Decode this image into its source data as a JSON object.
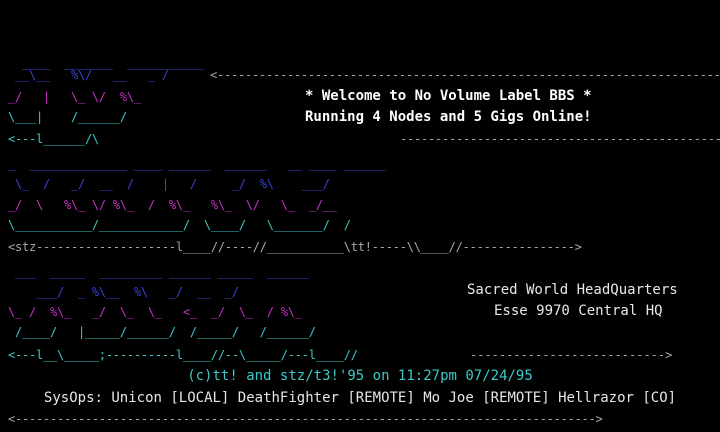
{
  "colors": {
    "background": "#000000",
    "cyan": "#3ec8c8",
    "blue": "#3a43d6",
    "magenta": "#c832c8",
    "gray": "#a8a8a8",
    "white": "#ffffff"
  },
  "header": {
    "welcome": "* Welcome to No Volume Label BBS *",
    "running": "Running 4 Nodes and 5 Gigs Online!"
  },
  "hq": {
    "line1": "Sacred World HeadQuarters",
    "line2": "Esse 9970 Central HQ"
  },
  "credits": "(c)tt! and stz/t3!'95 on 11:27pm 07/24/95",
  "sysops": "SysOps: Unicon [LOCAL] DeathFighter [REMOTE] Mo Joe [REMOTE] Hellrazor [CO]",
  "art": {
    "logo1": [
      {
        "text": "  ____  _______  ___________",
        "color": "blue"
      },
      {
        "text": " __\\__   %\\/   __   _ /",
        "color": "blue"
      },
      {
        "text": "_/   |   \\_ \\/  %\\_",
        "color": "magenta"
      },
      {
        "text": "\\___|    /______/",
        "color": "cyan"
      },
      {
        "text": "<---l______/\\",
        "color": "cyan"
      }
    ],
    "logo2": [
      {
        "text": "_  ______________ ____ ______  ______   __ ____ ______",
        "color": "blue"
      },
      {
        "text": " \\_  /   _/  __  /    |   /     _/  %\\    ___/",
        "color": "blue"
      },
      {
        "text": "_/  \\   %\\_ \\/ %\\_  /  %\\_   %\\_  \\/   \\_  _/__",
        "color": "magenta"
      },
      {
        "text": "\\___________/____________/  \\____/   \\_______/  /",
        "color": "cyan"
      }
    ],
    "logo3": [
      {
        "text": " ___  _____  _________ ______ _____  ______",
        "color": "blue"
      },
      {
        "text": "    ___/  _ %\\__  %\\   _/  __  _/",
        "color": "blue"
      },
      {
        "text": "\\_ /  %\\_   _/  \\_  \\_   <_  _/  \\_  / %\\_",
        "color": "magenta"
      },
      {
        "text": " /____/   |_____/______/  /_____/   /______/",
        "color": "cyan"
      }
    ],
    "sep1": "<---------------------------------------------------------------------------------->",
    "sep2_left": "<---l______/\\",
    "sep2_right": "--------------------------------------------------------------------->",
    "sep3": "<stz--------------------l____//----//___________\\tt!-----\\\\____//---------------->",
    "sep4": "<---l__\\_____;----------l____//--\\_____/---l____//",
    "sep5": "<----------------------------------------------------------------------------------->"
  }
}
